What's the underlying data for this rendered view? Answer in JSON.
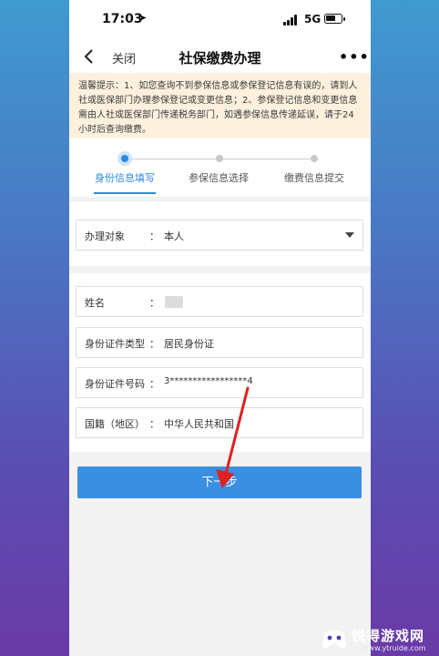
{
  "status_bar": {
    "time": "17:03",
    "network": "5G",
    "battery_level": 0.7
  },
  "nav": {
    "close_label": "关闭",
    "title": "社保缴费办理",
    "more_label": "•••"
  },
  "notice": {
    "text": "温馨提示：1、如您查询不到参保信息或参保登记信息有误的，请到人社或医保部门办理参保登记或变更信息；2、参保登记信息和变更信息需由人社或医保部门传递税务部门，如遇参保信息传递延误，请于24小时后查询缴费。"
  },
  "steps": [
    {
      "label": "身份信息填写",
      "active": true
    },
    {
      "label": "参保信息选择",
      "active": false
    },
    {
      "label": "缴费信息提交",
      "active": false
    }
  ],
  "form": {
    "handle_target": {
      "label": "办理对象",
      "colon": "：",
      "value": "本人"
    },
    "name": {
      "label": "姓名",
      "colon": "："
    },
    "id_type": {
      "label": "身份证件类型",
      "colon": "：",
      "value": "居民身份证"
    },
    "id_number": {
      "label": "身份证件号码",
      "colon": "：",
      "value": "3*****************4"
    },
    "nationality": {
      "label": "国籍（地区）",
      "colon": "：",
      "value": "中华人民共和国"
    }
  },
  "next_button": {
    "label": "下一步"
  },
  "colors": {
    "accent": "#2b89e0",
    "button": "#3a8fe2",
    "notice_bg": "#fdf1de",
    "arrow": "#e02020"
  },
  "watermark": {
    "main": "锐得游戏网",
    "url": "www.ytruide.com"
  }
}
